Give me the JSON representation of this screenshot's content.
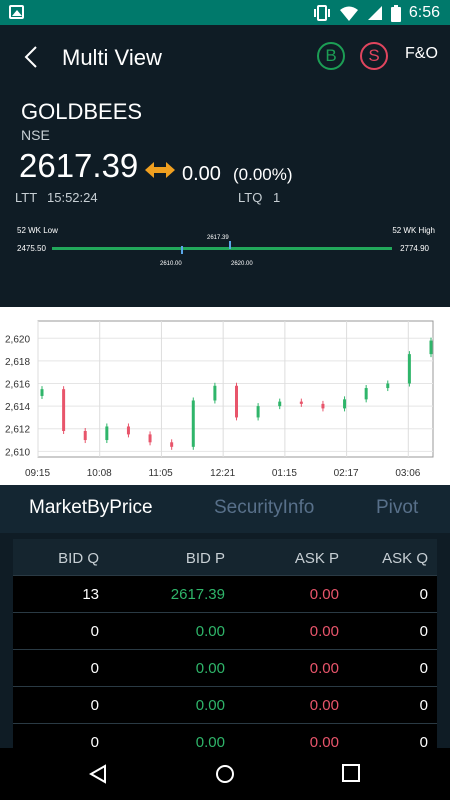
{
  "status_bar": {
    "time": "6:56"
  },
  "header": {
    "title": "Multi View",
    "buy_label": "B",
    "sell_label": "S",
    "fno_label": "F&O"
  },
  "quote": {
    "symbol": "GOLDBEES",
    "exchange": "NSE",
    "ltp": "2617.39",
    "change": "0.00",
    "change_pct": "(0.00%)",
    "ltt_label": "LTT",
    "ltt_value": "15:52:24",
    "ltq_label": "LTQ",
    "ltq_value": "1"
  },
  "week52": {
    "low_label": "52 WK Low",
    "high_label": "52 WK High",
    "low_value": "2475.50",
    "high_value": "2774.90",
    "ltp_value": "2617.39",
    "day_low": "2610.00",
    "day_high": "2620.00"
  },
  "chart_data": {
    "type": "candlestick",
    "y_ticks": [
      "2,620",
      "2,618",
      "2,616",
      "2,614",
      "2,612",
      "2,610"
    ],
    "x_ticks": [
      "09:15",
      "10:08",
      "11:05",
      "12:21",
      "01:15",
      "02:17",
      "03:06"
    ],
    "ylim": [
      2609.5,
      2621
    ],
    "up_color": "#2fb56a",
    "down_color": "#e8556b",
    "series": [
      {
        "x": "09:15",
        "close": 2615.5
      },
      {
        "x": "09:30",
        "close": 2611.8
      },
      {
        "x": "09:45",
        "close": 2611.0
      },
      {
        "x": "10:08",
        "close": 2612.2
      },
      {
        "x": "10:30",
        "close": 2611.5
      },
      {
        "x": "10:50",
        "close": 2610.8
      },
      {
        "x": "11:05",
        "close": 2610.4
      },
      {
        "x": "11:20",
        "close": 2614.5
      },
      {
        "x": "11:40",
        "close": 2615.8
      },
      {
        "x": "12:00",
        "close": 2613.0
      },
      {
        "x": "12:21",
        "close": 2614.0
      },
      {
        "x": "12:45",
        "close": 2614.4
      },
      {
        "x": "01:15",
        "close": 2614.2
      },
      {
        "x": "01:45",
        "close": 2613.8
      },
      {
        "x": "02:17",
        "close": 2614.6
      },
      {
        "x": "02:40",
        "close": 2615.6
      },
      {
        "x": "03:06",
        "close": 2616.0
      },
      {
        "x": "03:20",
        "close": 2618.6
      },
      {
        "x": "03:30",
        "close": 2619.8
      }
    ]
  },
  "tabs": [
    {
      "label": "MarketByPrice",
      "active": true
    },
    {
      "label": "SecurityInfo",
      "active": false
    },
    {
      "label": "Pivot",
      "active": false
    }
  ],
  "depth": {
    "headers": [
      "BID Q",
      "BID P",
      "ASK P",
      "ASK Q"
    ],
    "rows": [
      [
        "13",
        "2617.39",
        "0.00",
        "0"
      ],
      [
        "0",
        "0.00",
        "0.00",
        "0"
      ],
      [
        "0",
        "0.00",
        "0.00",
        "0"
      ],
      [
        "0",
        "0.00",
        "0.00",
        "0"
      ],
      [
        "0",
        "0.00",
        "0.00",
        "0"
      ]
    ]
  }
}
